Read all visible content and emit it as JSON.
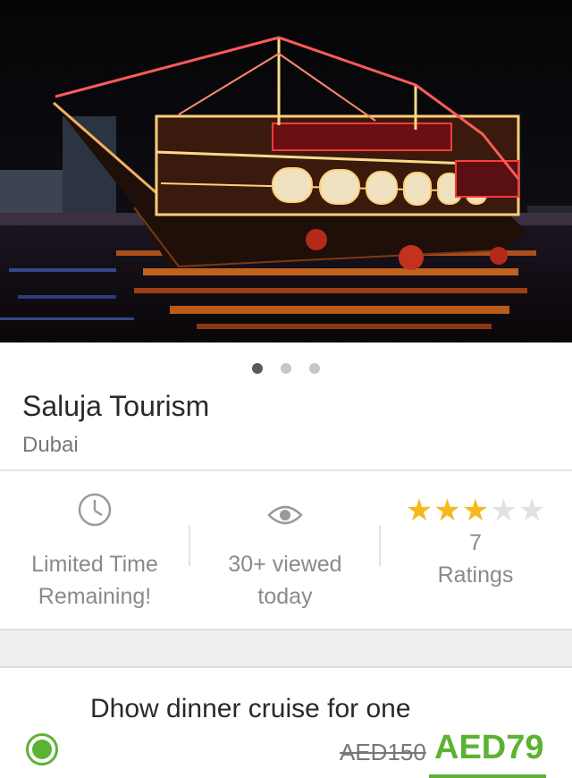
{
  "hero": {
    "image_label": "dhow-cruise-photo",
    "pager_count": 3,
    "pager_active": 0
  },
  "listing": {
    "title": "Saluja Tourism",
    "city": "Dubai"
  },
  "stats": {
    "time": {
      "line1": "Limited Time",
      "line2": "Remaining!",
      "icon": "clock-icon"
    },
    "views": {
      "line1": "30+ viewed",
      "line2": "today",
      "icon": "eye-icon"
    },
    "rating": {
      "count": "7",
      "label": "Ratings",
      "stars": 3,
      "max_stars": 5
    }
  },
  "deal": {
    "title": "Dhow dinner cruise for one",
    "old_price": "AED150",
    "new_price": "AED79",
    "selected": true
  },
  "colors": {
    "accent_green": "#5cb331",
    "star_gold": "#f6b81c",
    "star_empty": "#e1e1e1",
    "text_dark": "#2a2a2a",
    "text_muted": "#8a8a8a"
  }
}
